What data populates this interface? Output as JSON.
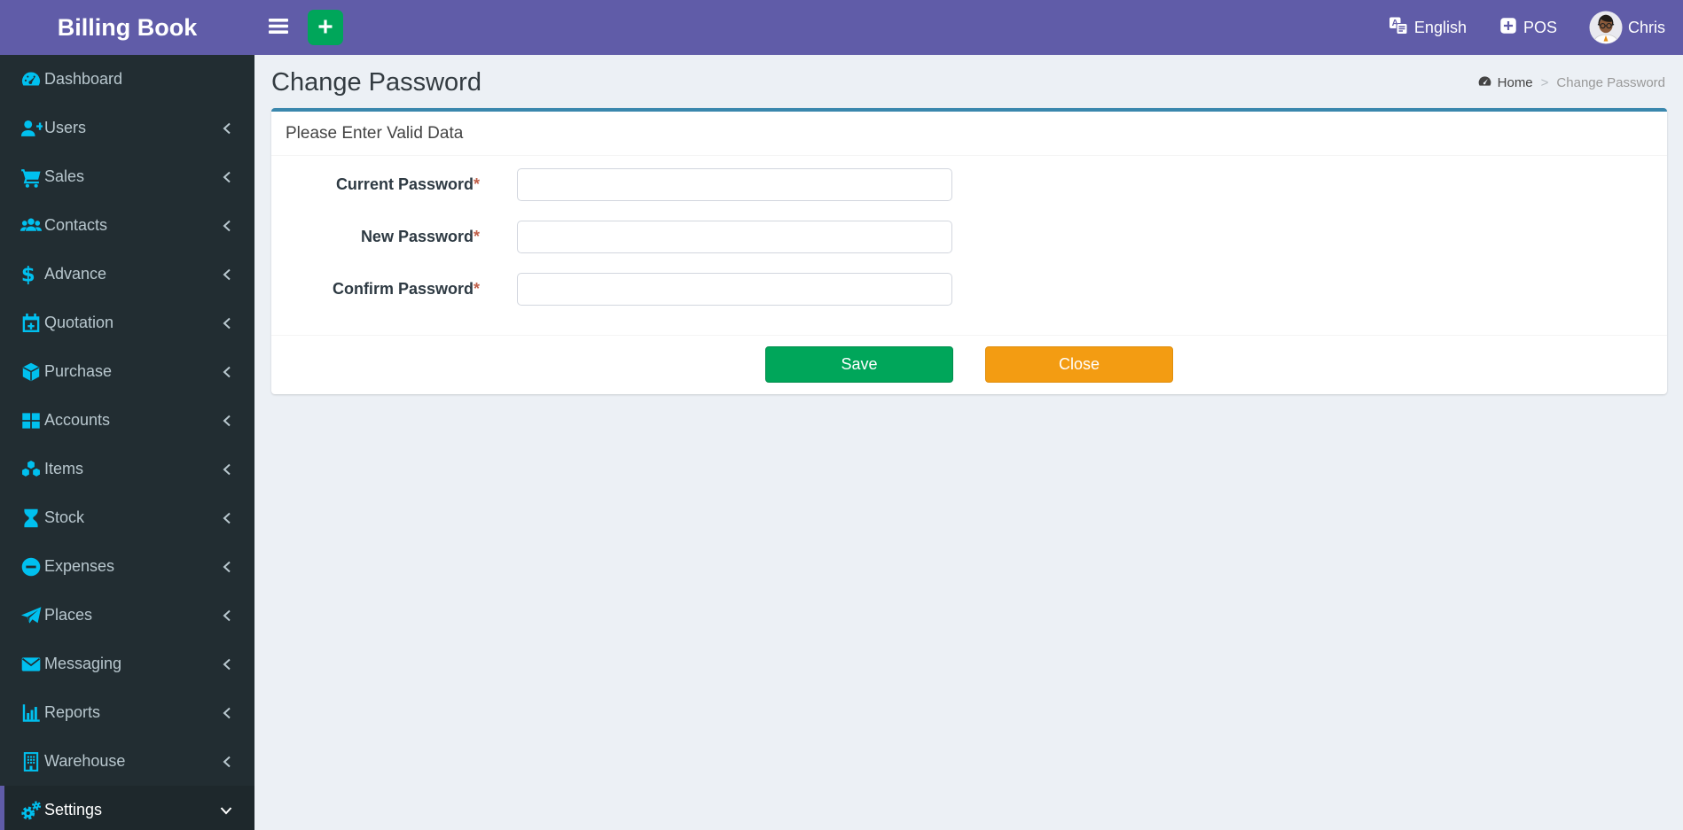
{
  "app": {
    "name": "Billing Book"
  },
  "navbar": {
    "language": {
      "label": "English"
    },
    "pos": {
      "label": "POS"
    },
    "user": {
      "name": "Chris"
    }
  },
  "sidebar": {
    "items": [
      {
        "label": "Dashboard",
        "icon": "dashboard-icon",
        "has_children": false,
        "active": false
      },
      {
        "label": "Users",
        "icon": "user-plus-icon",
        "has_children": true,
        "active": false
      },
      {
        "label": "Sales",
        "icon": "cart-icon",
        "has_children": true,
        "active": false
      },
      {
        "label": "Contacts",
        "icon": "users-icon",
        "has_children": true,
        "active": false
      },
      {
        "label": "Advance",
        "icon": "dollar-icon",
        "has_children": true,
        "active": false
      },
      {
        "label": "Quotation",
        "icon": "calendar-plus-icon",
        "has_children": true,
        "active": false
      },
      {
        "label": "Purchase",
        "icon": "cube-icon",
        "has_children": true,
        "active": false
      },
      {
        "label": "Accounts",
        "icon": "grid-icon",
        "has_children": true,
        "active": false
      },
      {
        "label": "Items",
        "icon": "cubes-icon",
        "has_children": true,
        "active": false
      },
      {
        "label": "Stock",
        "icon": "hourglass-icon",
        "has_children": true,
        "active": false
      },
      {
        "label": "Expenses",
        "icon": "minus-circle-icon",
        "has_children": true,
        "active": false
      },
      {
        "label": "Places",
        "icon": "paper-plane-icon",
        "has_children": true,
        "active": false
      },
      {
        "label": "Messaging",
        "icon": "envelope-icon",
        "has_children": true,
        "active": false
      },
      {
        "label": "Reports",
        "icon": "bar-chart-icon",
        "has_children": true,
        "active": false
      },
      {
        "label": "Warehouse",
        "icon": "building-icon",
        "has_children": true,
        "active": false
      },
      {
        "label": "Settings",
        "icon": "gears-icon",
        "has_children": true,
        "active": true,
        "expanded": true
      }
    ]
  },
  "page": {
    "title": "Change Password",
    "breadcrumb": {
      "home": "Home",
      "separator": ">",
      "current": "Change Password"
    }
  },
  "form": {
    "heading": "Please Enter Valid Data",
    "required_marker": "*",
    "fields": [
      {
        "label": "Current Password",
        "value": ""
      },
      {
        "label": "New Password",
        "value": ""
      },
      {
        "label": "Confirm Password",
        "value": ""
      }
    ],
    "buttons": {
      "save": "Save",
      "close": "Close"
    }
  },
  "colors": {
    "header_purple": "#605ca8",
    "sidebar_bg": "#222d32",
    "sidebar_active_bg": "#1e282c",
    "sidebar_icon_cyan": "#00c0ef",
    "content_bg": "#ecf0f5",
    "card_top_border": "#3a87ad",
    "save_green": "#00a65a",
    "close_orange": "#f39c12",
    "required_red": "#c0604a"
  }
}
